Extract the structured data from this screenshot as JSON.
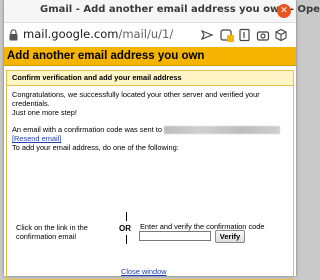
{
  "window": {
    "title": "Gmail - Add another email address you own - Opera",
    "close_glyph": "✕"
  },
  "addressbar": {
    "url_domain": "mail.google.com",
    "url_path": "/mail/u/1/"
  },
  "colors": {
    "header_bg": "#f4b400",
    "panel_header_bg": "#fff5c7",
    "link": "#1f3fb0",
    "close_button": "#e95420"
  },
  "page": {
    "header": "Add another email address you own",
    "panel_title": "Confirm verification and add your email address",
    "congrats_line1": "Congratulations, we successfully located your other server and verified your credentials.",
    "congrats_line2": "Just one more step!",
    "sent_text": "An email with a confirmation code was sent to",
    "resend_link": "[Resend email]",
    "instruction": "To add your email address, do one of the following:",
    "option_left": "Click on the link in the confirmation email",
    "or_label": "OR",
    "option_right": "Enter and verify the confirmation code",
    "code_value": "",
    "verify_button": "Verify",
    "close_window": "Close window"
  }
}
